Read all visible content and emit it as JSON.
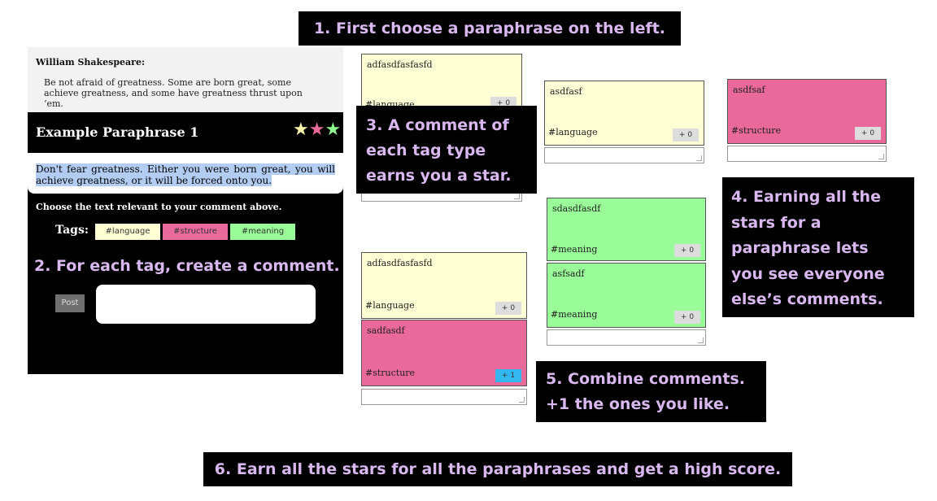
{
  "callouts": {
    "c1": "1. First choose a paraphrase on the left.",
    "c2": "2. For each tag, create a comment.",
    "c3": "3. A comment of each tag type earns you a star.",
    "c4": "4. Earning all the stars for a paraphrase lets you see everyone else’s comments.",
    "c5": "5. Combine comments. +1 the ones you like.",
    "c6": "6. Earn all the stars for all the paraphrases and get a high score."
  },
  "panel": {
    "author": "William Shakespeare:",
    "quote": "Be not afraid of greatness. Some are born great, some achieve greatness, and some have greatness thrust upon ‘em.",
    "paraphrase_title": "Example Paraphrase 1",
    "paraphrase_text": "Don't fear greatness. Either you were born great, you will achieve greatness, or it will be forced onto you.",
    "choose_text": "Choose the text relevant to your comment above.",
    "tags_label": "Tags:",
    "tags": [
      "#language",
      "#structure",
      "#meaning"
    ],
    "post_label": "Post",
    "star_colors": [
      "#f7f2a8",
      "#e8699a",
      "#8ef78e"
    ]
  },
  "cards": [
    {
      "text": "adfasdfasfasfd",
      "tag": "#language",
      "votes": "+ 0"
    },
    {
      "text": "asdfasf",
      "tag": "#language",
      "votes": "+ 0"
    },
    {
      "text": "asdfsaf",
      "tag": "#structure",
      "votes": "+ 0"
    },
    {
      "text": "sdasdfasdf",
      "tag": "#meaning",
      "votes": "+ 0"
    },
    {
      "text": "asfsadf",
      "tag": "#meaning",
      "votes": "+ 0"
    },
    {
      "text": "adfasdfasfasfd",
      "tag": "#language",
      "votes": "+ 0"
    },
    {
      "text": "sadfasdf",
      "tag": "#structure",
      "votes": "+ 1"
    }
  ],
  "colors": {
    "language": "#ffffd6",
    "structure": "#e8699a",
    "meaning": "#99fc99",
    "callout_text": "#d9b8f0",
    "plus_one_active": "#33b7f0"
  }
}
